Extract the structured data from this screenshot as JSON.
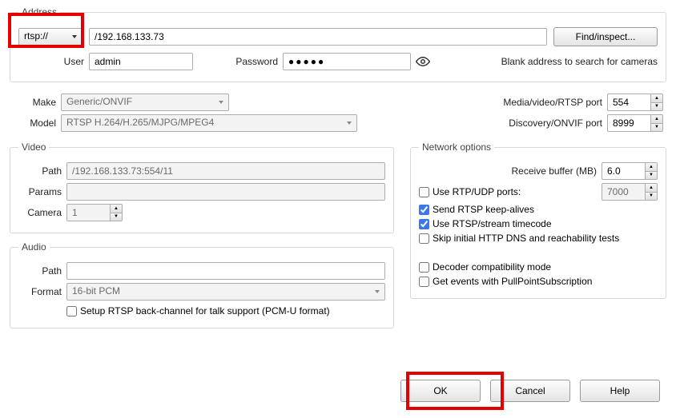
{
  "address": {
    "legend": "Address",
    "protocol": "rtsp://",
    "url": "/192.168.133.73",
    "findButton": "Find/inspect...",
    "userLabel": "User",
    "userValue": "admin",
    "passwordLabel": "Password",
    "passwordValue": "●●●●●",
    "blankNote": "Blank address to search for cameras"
  },
  "device": {
    "makeLabel": "Make",
    "makeValue": "Generic/ONVIF",
    "modelLabel": "Model",
    "modelValue": "RTSP H.264/H.265/MJPG/MPEG4",
    "mediaPortLabel": "Media/video/RTSP port",
    "mediaPortValue": "554",
    "discoveryPortLabel": "Discovery/ONVIF port",
    "discoveryPortValue": "8999"
  },
  "video": {
    "legend": "Video",
    "pathLabel": "Path",
    "pathValue": "/192.168.133.73:554/11",
    "paramsLabel": "Params",
    "paramsValue": "",
    "cameraLabel": "Camera",
    "cameraValue": "1"
  },
  "audio": {
    "legend": "Audio",
    "pathLabel": "Path",
    "pathValue": "",
    "formatLabel": "Format",
    "formatValue": "16-bit PCM",
    "backChannelLabel": "Setup RTSP back-channel for talk support (PCM-U format)"
  },
  "network": {
    "legend": "Network options",
    "receiveBufferLabel": "Receive buffer (MB)",
    "receiveBufferValue": "6.0",
    "useRtpLabel": "Use RTP/UDP ports:",
    "useRtpValue": "7000",
    "sendKeepAliveLabel": "Send RTSP keep-alives",
    "useTimecodeLabel": "Use RTSP/stream timecode",
    "skipDnsLabel": "Skip initial HTTP DNS and reachability tests",
    "decoderCompatLabel": "Decoder compatibility mode",
    "pullPointLabel": "Get events with PullPointSubscription"
  },
  "buttons": {
    "ok": "OK",
    "cancel": "Cancel",
    "help": "Help"
  }
}
